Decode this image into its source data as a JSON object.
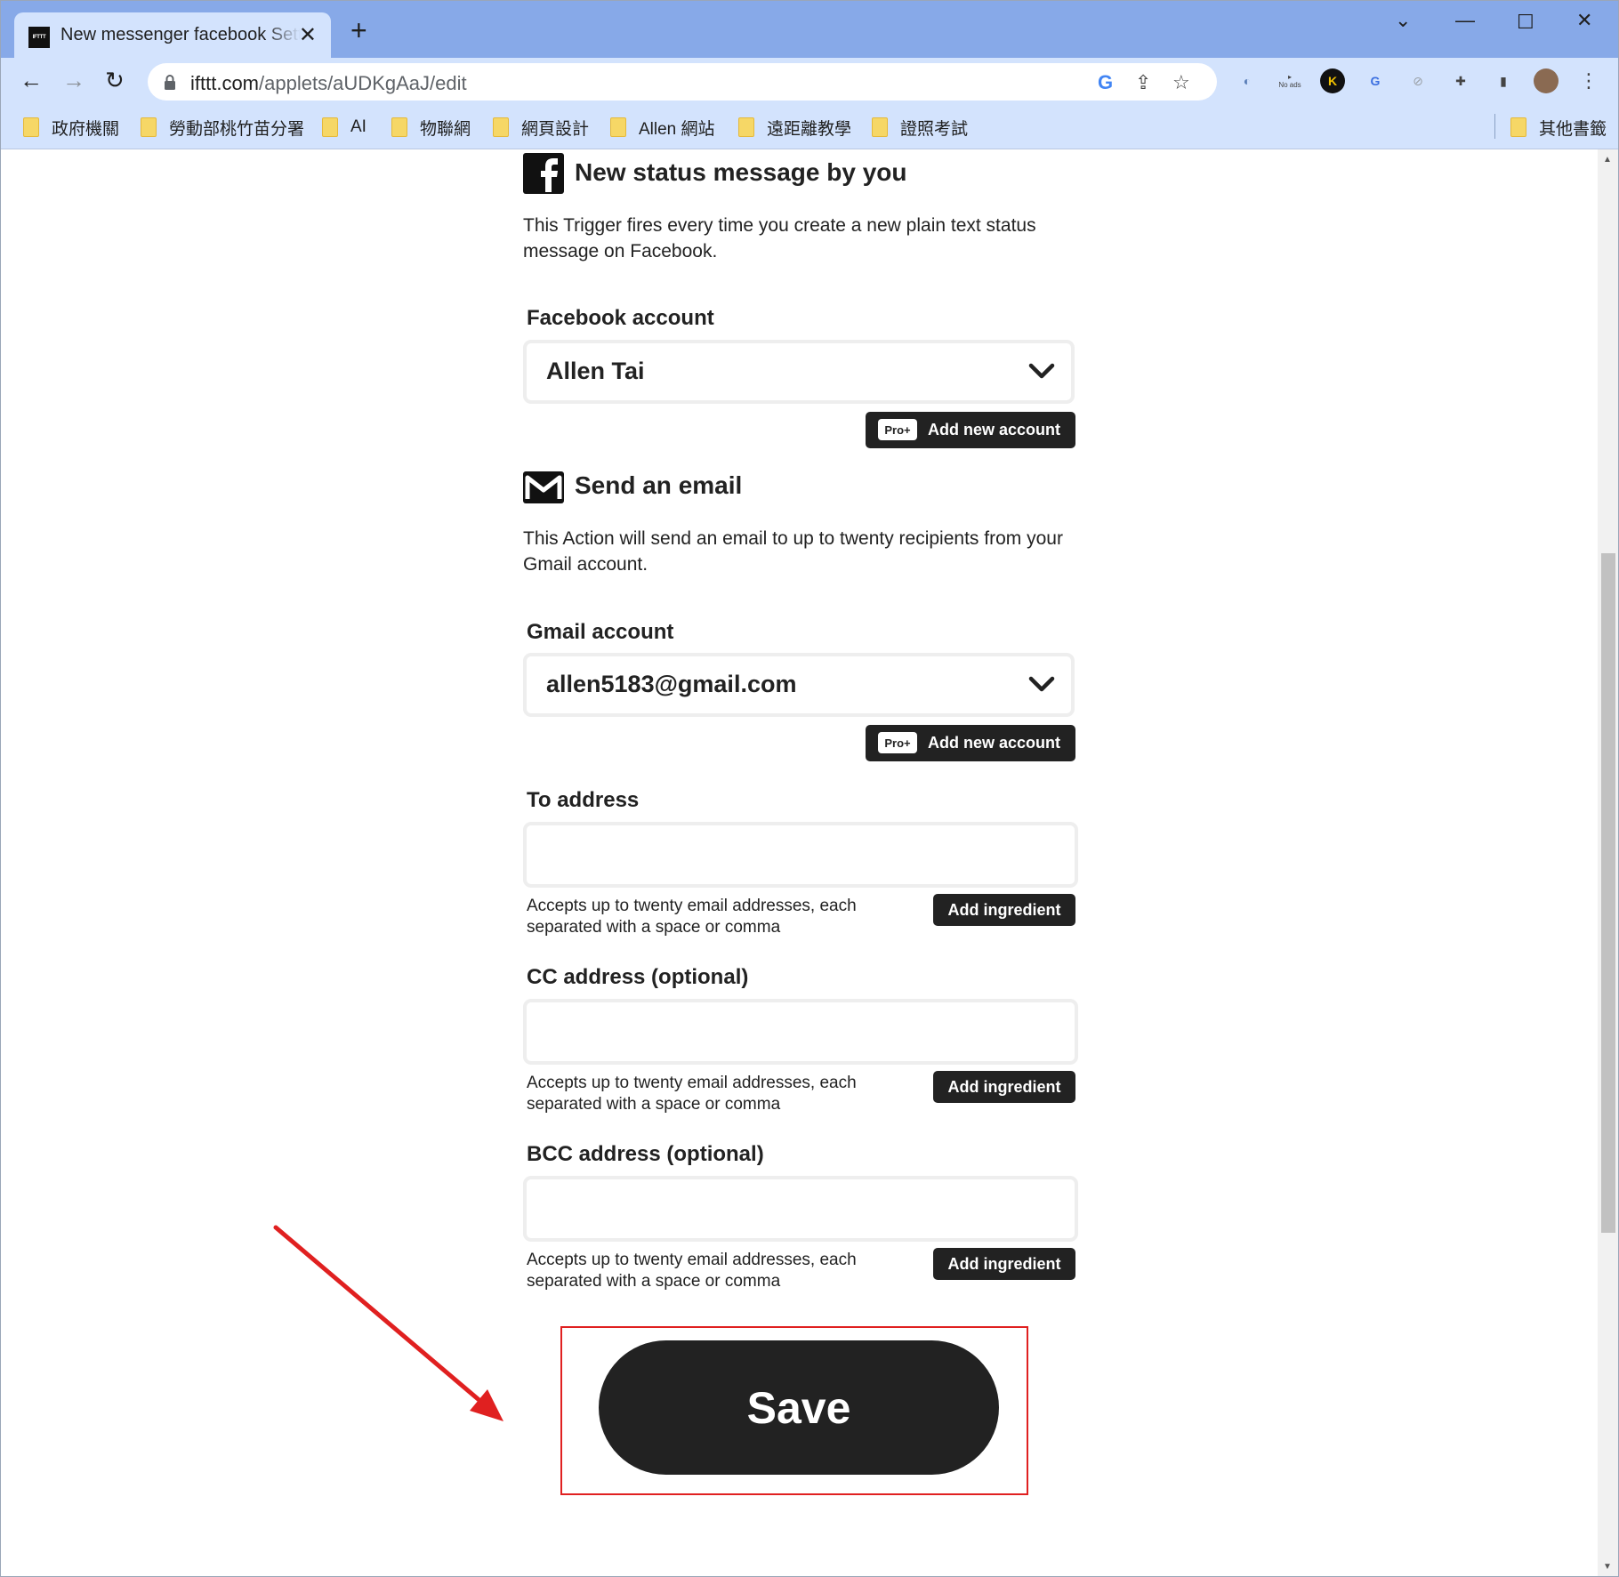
{
  "browser": {
    "tab_title": "New messenger facebook Settings",
    "favicon_text": "IFTTT",
    "url_host": "ifttt.com",
    "url_path": "/applets/aUDKgAaJ/edit",
    "no_ads_label": "No ads",
    "bookmarks": [
      "政府機關",
      "勞動部桃竹苗分署",
      "AI",
      "物聯網",
      "網頁設計",
      "Allen 網站",
      "遠距離教學",
      "證照考試"
    ],
    "other_bookmarks": "其他書籤"
  },
  "trigger": {
    "icon": "facebook-icon",
    "title": "New status message by you",
    "description": "This Trigger fires every time you create a new plain text status message on Facebook.",
    "account_label": "Facebook account",
    "account_value": "Allen Tai",
    "pro_badge": "Pro+",
    "add_account_label": "Add new account"
  },
  "action": {
    "icon": "gmail-icon",
    "title": "Send an email",
    "description": "This Action will send an email to up to twenty recipients from your Gmail account.",
    "account_label": "Gmail account",
    "account_value": "allen5183@gmail.com",
    "pro_badge": "Pro+",
    "add_account_label": "Add new account",
    "fields": [
      {
        "label": "To address",
        "value": "",
        "helper": "Accepts up to twenty email addresses, each separated with a space or comma",
        "button": "Add ingredient"
      },
      {
        "label": "CC address (optional)",
        "value": "",
        "helper": "Accepts up to twenty email addresses, each separated with a space or comma",
        "button": "Add ingredient"
      },
      {
        "label": "BCC address (optional)",
        "value": "",
        "helper": "Accepts up to twenty email addresses, each separated with a space or comma",
        "button": "Add ingredient"
      }
    ]
  },
  "save_label": "Save",
  "colors": {
    "accent": "#222222",
    "annotation": "#e02020",
    "browser_frame": "#87a9e8"
  }
}
